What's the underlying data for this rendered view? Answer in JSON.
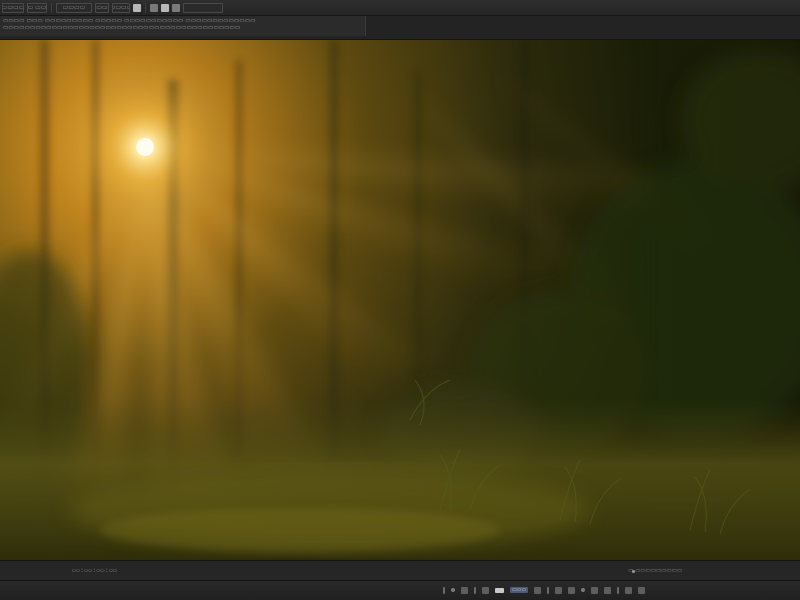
{
  "app": {
    "toolbar": {
      "items": [
        {
          "name": "menu-file",
          "label": "▭▭▭▭"
        },
        {
          "name": "menu-edit",
          "label": "▭ ▭▭"
        },
        {
          "name": "menu-view",
          "label": "▭▭▭▭"
        },
        {
          "name": "menu-mark",
          "label": "▭▭"
        },
        {
          "name": "menu-zoom",
          "label": "▭▭▭▭"
        }
      ]
    },
    "info": {
      "line1": "▭▭▭▭ ▭▭▭  ▭▭▭▭▭▭▭▭▭ ▭▭▭▭▭ ▭▭▭▭▭▭▭▭▭▭▭ ▭▭▭▭▭▭▭▭▭▭▭▭▭",
      "line2": "▭▭▭▭▭▭▭▭▭▭▭▭▭▭▭▭▭▭▭▭▭▭▭▭▭▭▭▭▭▭▭▭▭▭▭▭▭▭▭▭▭▭▭▭"
    },
    "viewer": {
      "image_name": "sunlit forest with light rays",
      "accent_color": "#f2b53a"
    },
    "timeline": {
      "timecode": "▭▭:▭▭:▭▭:▭▭",
      "right_label": "▭ ▭▭▭▭▭▭▭▭▭"
    },
    "transport": {
      "field_label": "▭▭▭"
    }
  }
}
